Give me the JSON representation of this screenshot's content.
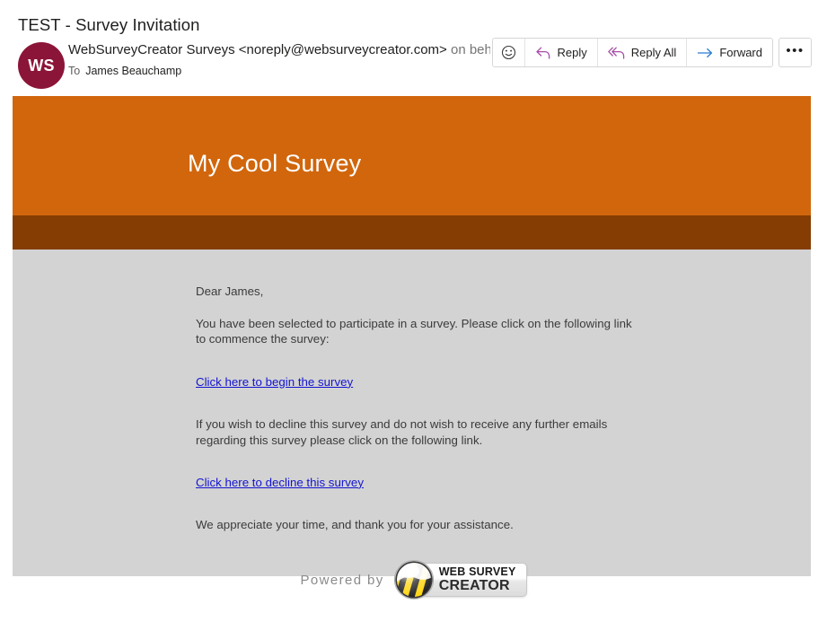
{
  "mail": {
    "subject": "TEST - Survey Invitation",
    "avatar_initials": "WS",
    "sender_name": "WebSurveyCreator Surveys",
    "sender_email": "<noreply@websurveycreator.com>",
    "on_behalf_text": "on beh",
    "to_label": "To",
    "recipient": "James Beauchamp"
  },
  "toolbar": {
    "emoji_icon": "smiley-icon",
    "reply_label": "Reply",
    "reply_all_label": "Reply All",
    "forward_label": "Forward",
    "more_label": "•••",
    "reply_icon_color": "#A64CA6",
    "forward_icon_color": "#2B7CD3"
  },
  "email_body": {
    "banner_title": "My Cool Survey",
    "banner_color": "#D1660C",
    "stripe_color": "#853D03",
    "content_bg": "#D3D3D3",
    "greeting": "Dear James,",
    "intro_paragraph": "You have been selected to participate in a survey. Please click on the following link to commence the survey:",
    "begin_link": "Click here to begin the survey",
    "decline_paragraph": "If you wish to decline this survey and do not wish to receive any further emails regarding this survey please click on the following link.",
    "decline_link": "Click here to decline this survey",
    "closing": "We appreciate your time, and thank you for your assistance.",
    "link_color": "#1414D2"
  },
  "footer": {
    "powered_by": "Powered by",
    "logo_line1": "WEB SURVEY",
    "logo_line2": "CREATOR",
    "logo_icon": "websurveycreator-sphere-logo"
  }
}
